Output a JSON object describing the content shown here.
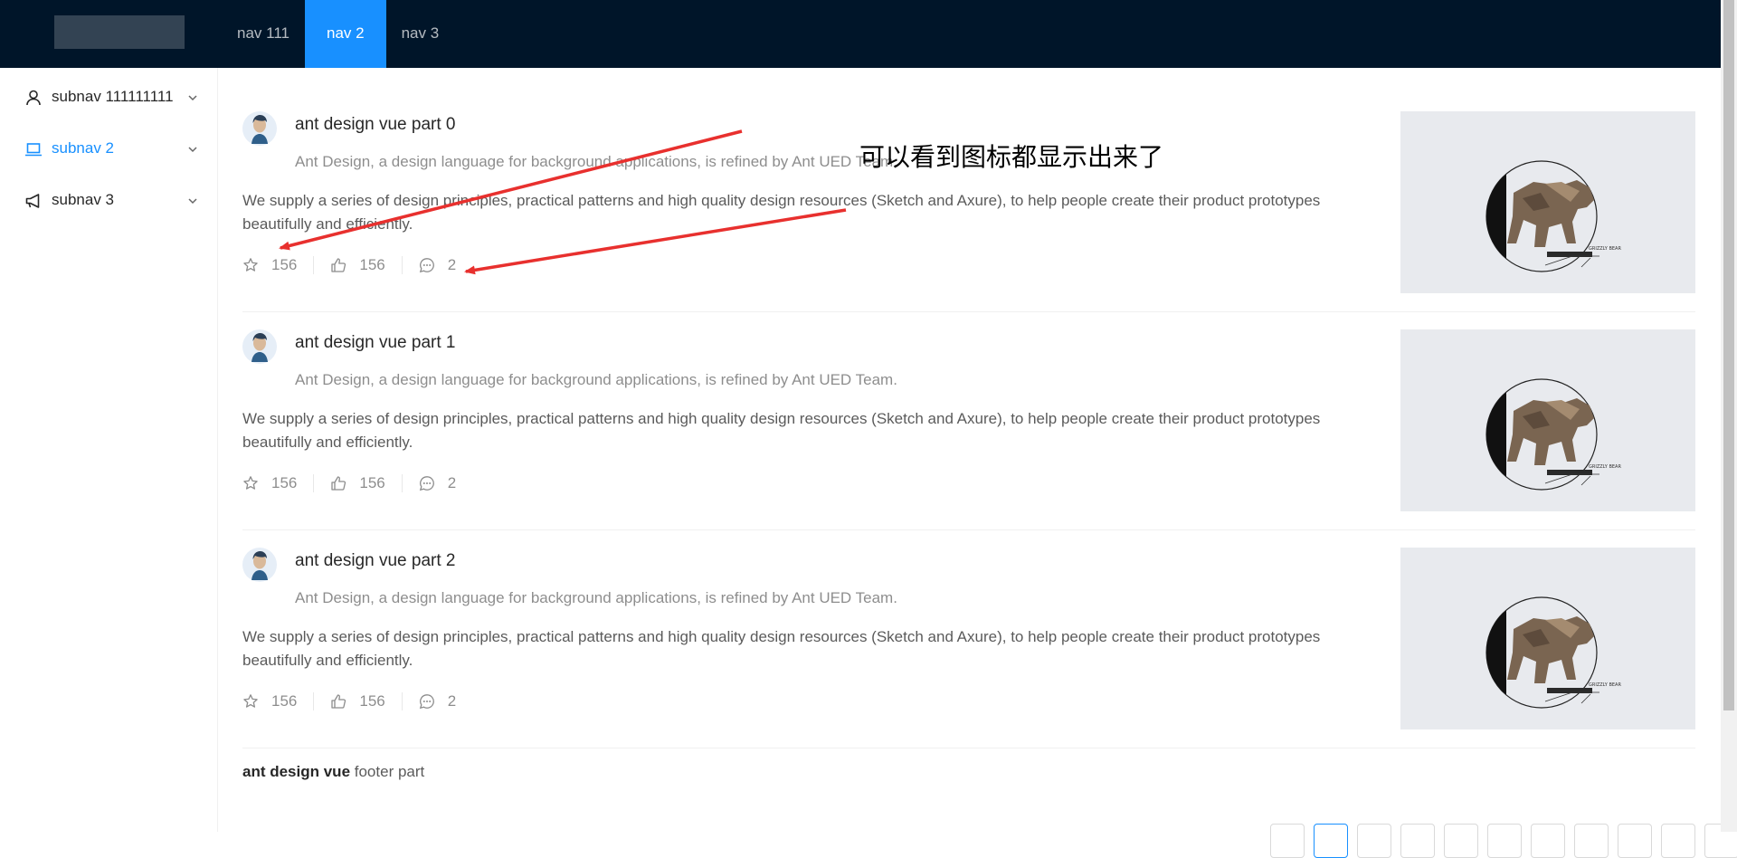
{
  "header": {
    "nav": [
      {
        "label": "nav 111",
        "active": false
      },
      {
        "label": "nav 2",
        "active": true
      },
      {
        "label": "nav 3",
        "active": false
      }
    ]
  },
  "sidebar": {
    "items": [
      {
        "label": "subnav 111111111",
        "icon": "user-icon"
      },
      {
        "label": "subnav 2",
        "icon": "laptop-icon"
      },
      {
        "label": "subnav 3",
        "icon": "notification-icon"
      }
    ]
  },
  "list": {
    "items": [
      {
        "title": "ant design vue part 0",
        "description": "Ant Design, a design language for background applications, is refined by Ant UED Team.",
        "content": "We supply a series of design principles, practical patterns and high quality design resources (Sketch and Axure), to help people create their product prototypes beautifully and efficiently.",
        "stars": "156",
        "likes": "156",
        "messages": "2"
      },
      {
        "title": "ant design vue part 1",
        "description": "Ant Design, a design language for background applications, is refined by Ant UED Team.",
        "content": "We supply a series of design principles, practical patterns and high quality design resources (Sketch and Axure), to help people create their product prototypes beautifully and efficiently.",
        "stars": "156",
        "likes": "156",
        "messages": "2"
      },
      {
        "title": "ant design vue part 2",
        "description": "Ant Design, a design language for background applications, is refined by Ant UED Team.",
        "content": "We supply a series of design principles, practical patterns and high quality design resources (Sketch and Axure), to help people create their product prototypes beautifully and efficiently.",
        "stars": "156",
        "likes": "156",
        "messages": "2"
      }
    ],
    "thumbnail_text": "GRIZZLY BEAR"
  },
  "footer": {
    "bold": "ant design vue",
    "rest": " footer part"
  },
  "annotation": {
    "text": "可以看到图标都显示出来了"
  },
  "colors": {
    "header": "#001529",
    "accent": "#1890ff",
    "arrow": "#e8302e"
  }
}
